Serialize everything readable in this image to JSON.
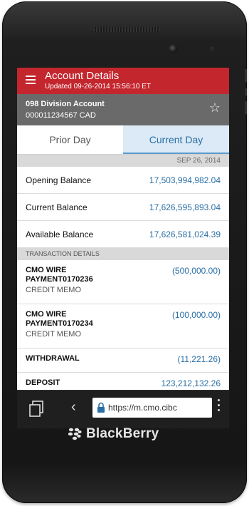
{
  "header": {
    "title": "Account Details",
    "updated": "Updated  09-26-2014  15:56:10 ET"
  },
  "account": {
    "name": "098 Division Account",
    "number": "000011234567 CAD"
  },
  "tabs": [
    {
      "label": "Prior Day"
    },
    {
      "label": "Current Day"
    }
  ],
  "date": "SEP 26, 2014",
  "balances": [
    {
      "label": "Opening Balance",
      "value": "17,503,994,982.04"
    },
    {
      "label": "Current Balance",
      "value": "17,626,595,893.04"
    },
    {
      "label": "Available Balance",
      "value": "17,626,581,024.39"
    }
  ],
  "section_title": "TRANSACTION DETAILS",
  "transactions": [
    {
      "title": "CMO WIRE PAYMENT0170236",
      "subtitle": "CREDIT MEMO",
      "amount": "(500,000.00)"
    },
    {
      "title": "CMO WIRE PAYMENT0170234",
      "subtitle": "CREDIT MEMO",
      "amount": "(100,000.00)"
    },
    {
      "title": "WITHDRAWAL",
      "amount": "(11,221.26)"
    },
    {
      "title": "DEPOSIT",
      "amount": "123,212,132.26"
    }
  ],
  "browser": {
    "url": "https://m.cmo.cibc"
  },
  "brand": "BlackBerry",
  "colors": {
    "header": "#c4262e",
    "accent": "#2a6fa5"
  }
}
